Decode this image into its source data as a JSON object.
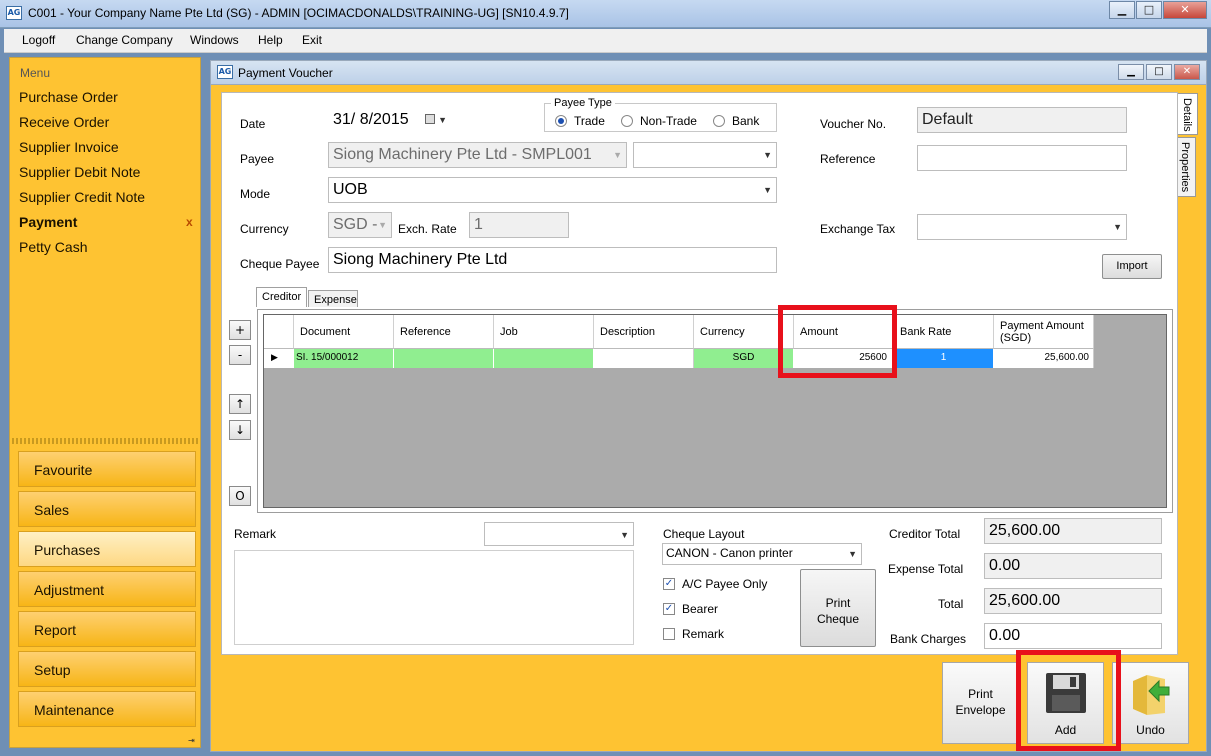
{
  "window": {
    "title": "C001 - Your Company Name Pte Ltd (SG) - ADMIN [OCIMACDONALDS\\TRAINING-UG] [SN10.4.9.7]",
    "app_icon_text": "AG",
    "minimize": "▁",
    "restore": "□",
    "close": "✕"
  },
  "menubar": [
    "Logoff",
    "Change Company",
    "Windows",
    "Help",
    "Exit"
  ],
  "sidebar": {
    "header": "Menu",
    "items": [
      "Purchase Order",
      "Receive Order",
      "Supplier Invoice",
      "Supplier Debit Note",
      "Supplier Credit Note",
      "Payment",
      "Petty Cash"
    ],
    "active_close": "x",
    "sections": [
      "Favourite",
      "Sales",
      "Purchases",
      "Adjustment",
      "Report",
      "Setup",
      "Maintenance"
    ],
    "scroll_arrow": "⇥"
  },
  "child": {
    "title": "Payment Voucher",
    "side_tabs": [
      "Details",
      "Properties"
    ]
  },
  "form": {
    "date_label": "Date",
    "date_value": "31/  8/2015",
    "payee_label": "Payee",
    "payee_value": "Siong Machinery Pte Ltd - SMPL001",
    "mode_label": "Mode",
    "mode_value": "UOB",
    "currency_label": "Currency",
    "currency_value": "SGD -",
    "exch_rate_label": "Exch. Rate",
    "exch_rate_value": "1",
    "cheque_payee_label": "Cheque Payee",
    "cheque_payee_value": "Siong Machinery Pte Ltd",
    "payee_type_label": "Payee Type",
    "payee_types": [
      "Trade",
      "Non-Trade",
      "Bank"
    ],
    "voucher_no_label": "Voucher No.",
    "voucher_no_value": "Default",
    "reference_label": "Reference",
    "exchange_tax_label": "Exchange Tax",
    "import_label": "Import"
  },
  "tabs": [
    "Creditor",
    "Expense"
  ],
  "grid": {
    "columns": [
      "Document",
      "Reference",
      "Job",
      "Description",
      "Currency",
      "Amount",
      "Bank Rate",
      "Payment Amount\n(SGD)"
    ],
    "rows": [
      {
        "document": "SI. 15/000012",
        "reference": "",
        "job": "",
        "description": "",
        "currency": "SGD",
        "amount": "25600",
        "bank_rate": "1",
        "payment_amount": "25,600.00"
      }
    ],
    "row_marker": "▶",
    "controls": [
      "+",
      "-",
      "↑",
      "↓",
      "O"
    ]
  },
  "bottom": {
    "remark_label": "Remark",
    "cheque_layout_label": "Cheque Layout",
    "cheque_layout_value": "CANON - Canon printer",
    "checkboxes": [
      {
        "label": "A/C Payee Only",
        "checked": true
      },
      {
        "label": "Bearer",
        "checked": true
      },
      {
        "label": "Remark",
        "checked": false
      }
    ],
    "check_mark": "✓",
    "print_cheque_line1": "Print",
    "print_cheque_line2": "Cheque",
    "creditor_total_label": "Creditor Total",
    "creditor_total_value": "25,600.00",
    "expense_total_label": "Expense Total",
    "expense_total_value": "0.00",
    "total_label": "Total",
    "total_value": "25,600.00",
    "bank_charges_label": "Bank Charges",
    "bank_charges_value": "0.00"
  },
  "actions": {
    "print_envelope_line1": "Print",
    "print_envelope_line2": "Envelope",
    "add_label": "Add",
    "undo_label": "Undo"
  },
  "colors": {
    "sidebar_bg": "#fec332",
    "highlight": "#e8101b",
    "grid_green": "#90ee90",
    "bank_rate_blue": "#1e90ff"
  }
}
